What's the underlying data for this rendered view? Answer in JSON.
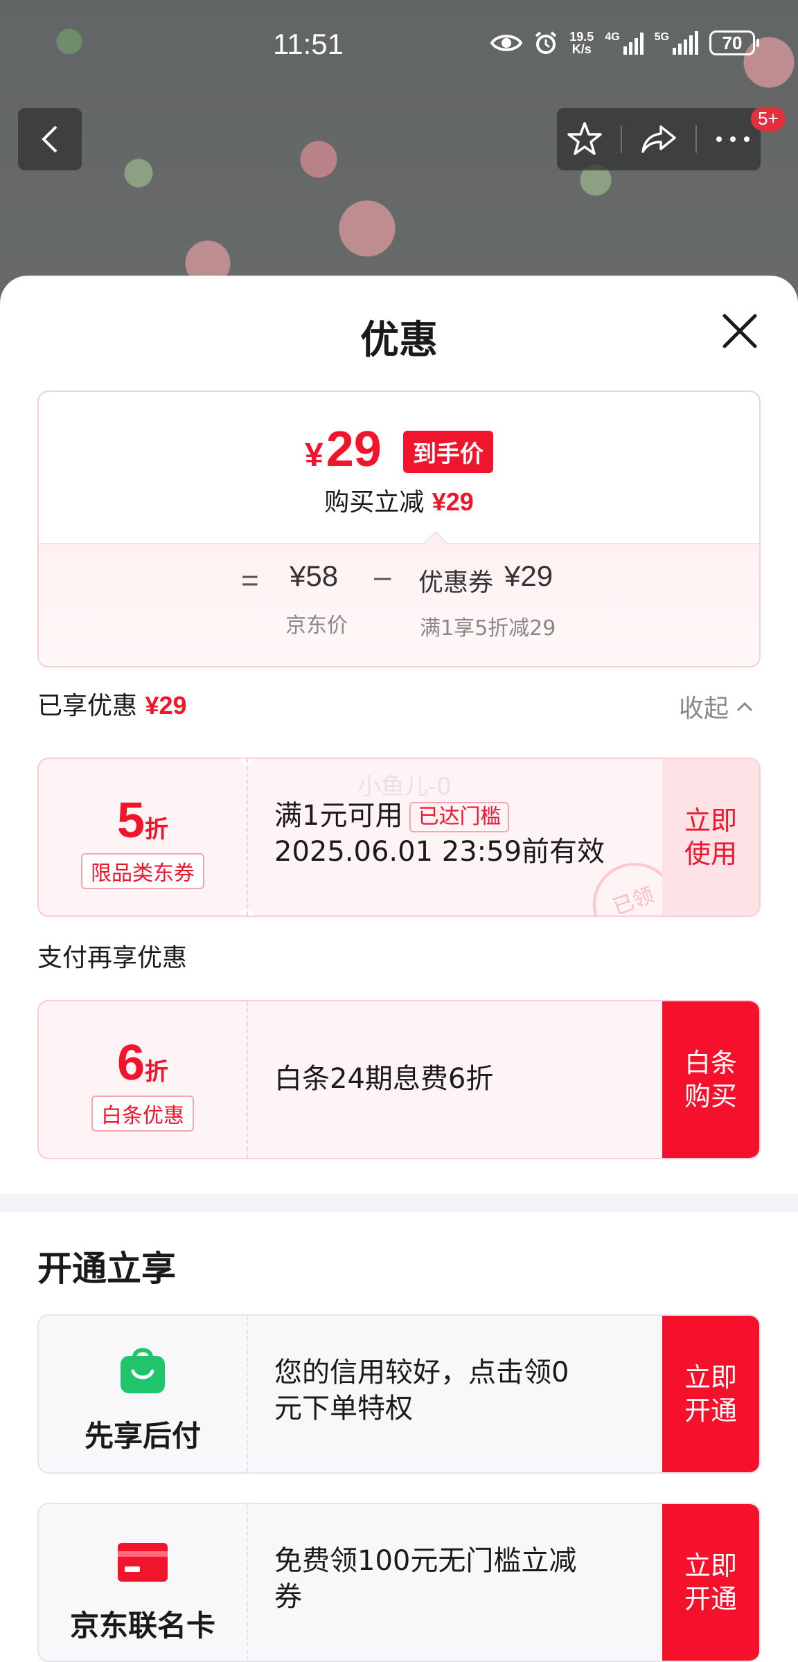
{
  "status_bar": {
    "time": "11:51",
    "net_speed_value": "19.5",
    "net_speed_unit": "K/s",
    "sig1_label": "4G",
    "sig2_label": "5G",
    "battery": "70"
  },
  "nav": {
    "badge": "5+"
  },
  "sheet": {
    "title": "优惠"
  },
  "price_card": {
    "final_price_symbol": "¥",
    "final_price": "29",
    "price_tag": "到手价",
    "sub_label": "购买立减",
    "sub_amount": "¥29",
    "equals": "=",
    "minus": "–",
    "jd_price": "¥58",
    "jd_price_label": "京东价",
    "coupon_label": "优惠券",
    "coupon_amount": "¥29",
    "coupon_rule": "满1享5折减29"
  },
  "enjoyed": {
    "label": "已享优惠",
    "amount": "¥29",
    "collapse_label": "收起"
  },
  "coupon1": {
    "discount_num": "5",
    "discount_unit": "折",
    "tag": "限品类东券",
    "condition": "满1元可用",
    "threshold_tag": "已达门槛",
    "validity": "2025.06.01 23:59前有效",
    "action_line1": "立即",
    "action_line2": "使用",
    "stamp": "已领",
    "watermark": "小鱼儿-0"
  },
  "payment_section": {
    "label": "支付再享优惠"
  },
  "coupon2": {
    "discount_num": "6",
    "discount_unit": "折",
    "tag": "白条优惠",
    "description": "白条24期息费6折",
    "action_line1": "白条",
    "action_line2": "购买"
  },
  "open_section": {
    "title": "开通立享"
  },
  "service1": {
    "name": "先享后付",
    "desc_line1": "您的信用较好，点击领0",
    "desc_line2": "元下单特权",
    "action_line1": "立即",
    "action_line2": "开通",
    "icon": "shopping-bag-icon",
    "icon_color": "#1fc46b"
  },
  "service2": {
    "name": "京东联名卡",
    "desc_line1": "免费领100元无门槛立减",
    "desc_line2": "券",
    "action_line1": "立即",
    "action_line2": "开通",
    "icon": "credit-card-icon",
    "icon_color": "#f0142c"
  },
  "colors": {
    "accent": "#f0142c",
    "solid_button": "#f5112b",
    "light_button": "#fde3e6"
  }
}
